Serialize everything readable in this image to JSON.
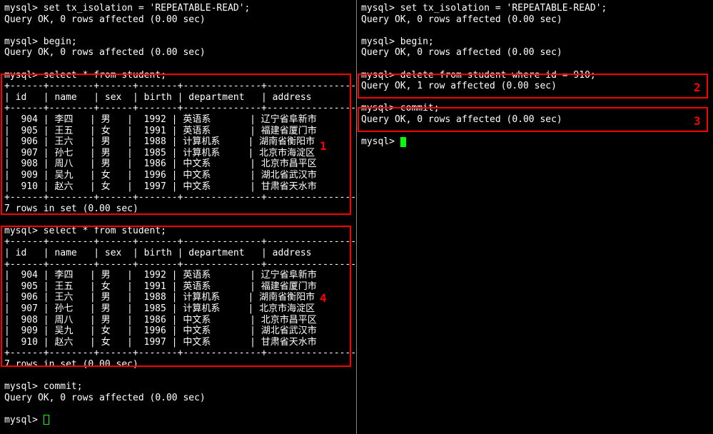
{
  "left": {
    "cmd1": "mysql> set tx_isolation = 'REPEATABLE-READ';",
    "res1": "Query OK, 0 rows affected (0.00 sec)",
    "cmd2": "mysql> begin;",
    "res2": "Query OK, 0 rows affected (0.00 sec)",
    "cmd3": "mysql> select * from student;",
    "sep": "+------+--------+------+-------+--------------+--------------------+",
    "hdr": "| id   | name   | sex  | birth | department   | address            |",
    "rows": [
      "|  904 | 李四   | 男   |  1992 | 英语系       | 辽宁省阜新市       |",
      "|  905 | 王五   | 女   |  1991 | 英语系       | 福建省厦门市       |",
      "|  906 | 王六   | 男   |  1988 | 计算机系     | 湖南省衡阳市       |",
      "|  907 | 孙七   | 男   |  1985 | 计算机系     | 北京市海淀区       |",
      "|  908 | 周八   | 男   |  1986 | 中文系       | 北京市昌平区       |",
      "|  909 | 吴九   | 女   |  1996 | 中文系       | 湖北省武汉市       |",
      "|  910 | 赵六   | 女   |  1997 | 中文系       | 甘肃省天水市       |"
    ],
    "rowcount": "7 rows in set (0.00 sec)",
    "cmd4": "mysql> select * from student;",
    "cmd5": "mysql> commit;",
    "res5": "Query OK, 0 rows affected (0.00 sec)",
    "prompt": "mysql> "
  },
  "right": {
    "cmd1": "mysql> set tx_isolation = 'REPEATABLE-READ';",
    "res1": "Query OK, 0 rows affected (0.00 sec)",
    "cmd2": "mysql> begin;",
    "res2": "Query OK, 0 rows affected (0.00 sec)",
    "cmd3": "mysql> delete from student where id = 910;",
    "res3": "Query OK, 1 row affected (0.00 sec)",
    "cmd4": "mysql> commit;",
    "res4": "Query OK, 0 rows affected (0.00 sec)",
    "prompt": "mysql> "
  },
  "labels": {
    "l1": "1",
    "l2": "2",
    "l3": "3",
    "l4": "4"
  }
}
